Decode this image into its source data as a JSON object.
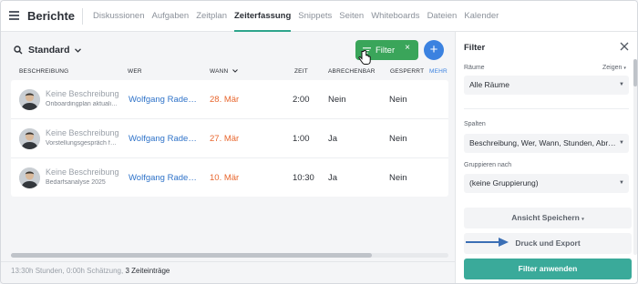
{
  "app": {
    "title": "Berichte",
    "tabs": [
      {
        "label": "Diskussionen",
        "active": false
      },
      {
        "label": "Aufgaben",
        "active": false
      },
      {
        "label": "Zeitplan",
        "active": false
      },
      {
        "label": "Zeiterfassung",
        "active": true
      },
      {
        "label": "Snippets",
        "active": false
      },
      {
        "label": "Seiten",
        "active": false
      },
      {
        "label": "Whiteboards",
        "active": false
      },
      {
        "label": "Dateien",
        "active": false
      },
      {
        "label": "Kalender",
        "active": false
      }
    ]
  },
  "toolbar": {
    "view_name": "Standard",
    "filter_label": "Filter",
    "filter_close": "×",
    "add_label": "+"
  },
  "table": {
    "columns": {
      "description": "BESCHREIBUNG",
      "who": "WER",
      "when": "WANN",
      "time": "ZEIT",
      "billable": "ABRECHENBAR",
      "locked": "GESPERRT",
      "more": "MEHR"
    },
    "rows": [
      {
        "description": "Keine Beschreibung",
        "task": "Onboardingplan aktualisieren",
        "who": "Wolfgang Rademacher",
        "when": "28. Mär",
        "time": "2:00",
        "billable": "Nein",
        "locked": "Nein"
      },
      {
        "description": "Keine Beschreibung",
        "task": "Vorstellungsgespräch führen",
        "who": "Wolfgang Rademacher",
        "when": "27. Mär",
        "time": "1:00",
        "billable": "Ja",
        "locked": "Nein"
      },
      {
        "description": "Keine Beschreibung",
        "task": "Bedarfsanalyse 2025",
        "who": "Wolfgang Rademacher",
        "when": "10. Mär",
        "time": "10:30",
        "billable": "Ja",
        "locked": "Nein"
      }
    ]
  },
  "footer": {
    "summary": "13:30h Stunden, 0:00h Schätzung,",
    "entries": "3 Zeiteinträge"
  },
  "panel": {
    "title": "Filter",
    "rooms_label": "Räume",
    "rooms_show": "Zeigen",
    "rooms_value": "Alle Räume",
    "columns_label": "Spalten",
    "columns_value": "Beschreibung, Wer, Wann, Stunden, Abrechenbar",
    "group_label": "Gruppieren nach",
    "group_value": "(keine Gruppierung)",
    "save_view": "Ansicht Speichern",
    "print_export": "Druck und Export",
    "apply": "Filter anwenden"
  }
}
